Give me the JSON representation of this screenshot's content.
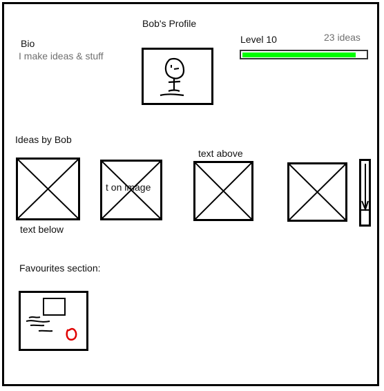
{
  "profile": {
    "title": "Bob's Profile",
    "bio_label": "Bio",
    "bio_text": "I make ideas & stuff",
    "avatar_icon": "stick-figure-avatar-icon",
    "level_label": "Level 10",
    "ideas_count": "23 ideas",
    "level_progress": 0.92,
    "progress_color": "#00ff00"
  },
  "ideas": {
    "heading": "Ideas by Bob",
    "items": [
      {
        "caption": "text below",
        "caption_position": "below"
      },
      {
        "caption": "t on image",
        "caption_position": "overlay"
      },
      {
        "caption": "text above",
        "caption_position": "above"
      },
      {
        "caption": "",
        "caption_position": "none"
      }
    ],
    "scroll_icon": "down-arrow-icon"
  },
  "favourites": {
    "heading": "Favourites section:",
    "accent_color": "#e00000"
  }
}
